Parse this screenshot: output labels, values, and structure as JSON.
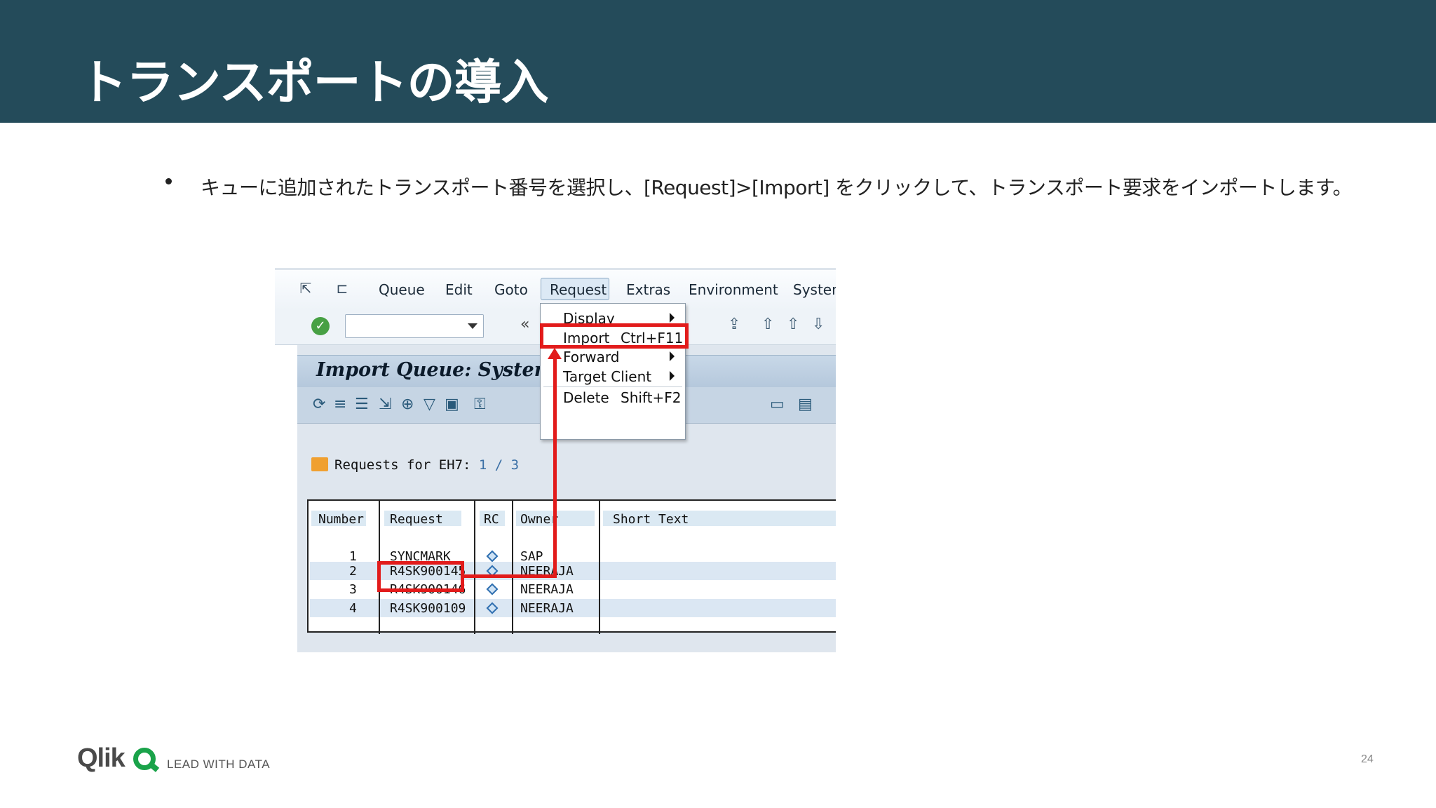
{
  "slide": {
    "title": "トランスポートの導入",
    "bullet": "キューに追加されたトランスポート番号を選択し、[Request]>[Import] をクリックして、トランスポート要求をインポートします。",
    "page_number": "24"
  },
  "sap": {
    "menu": {
      "items": [
        "Queue",
        "Edit",
        "Goto",
        "Request",
        "Extras",
        "Environment",
        "System"
      ],
      "active": "Request"
    },
    "screen_title": "Import Queue: System",
    "requests_label": "Requests for EH7:",
    "requests_count": "1 / 3",
    "dropdown": {
      "display": "Display",
      "import": "Import",
      "import_shortcut": "Ctrl+F11",
      "forward": "Forward",
      "target_client": "Target Client",
      "delete": "Delete",
      "delete_shortcut": "Shift+F2"
    },
    "table": {
      "columns": {
        "number": "Number",
        "request": "Request",
        "rc": "RC",
        "owner": "Owner",
        "short_text": "Short Text"
      },
      "rows": [
        {
          "number": "1",
          "request": "SYNCMARK",
          "owner": "SAP"
        },
        {
          "number": "2",
          "request": "R4SK900145",
          "owner": "NEERAJA"
        },
        {
          "number": "3",
          "request": "R4SK900146",
          "owner": "NEERAJA"
        },
        {
          "number": "4",
          "request": "R4SK900109",
          "owner": "NEERAJA"
        }
      ],
      "selected_row": "2"
    }
  },
  "footer": {
    "logo": "Qlik",
    "tagline": "LEAD WITH DATA"
  },
  "colors": {
    "header_bg": "#244b5a",
    "annotation_red": "#e21b1b",
    "qlik_green": "#1aa34a"
  }
}
